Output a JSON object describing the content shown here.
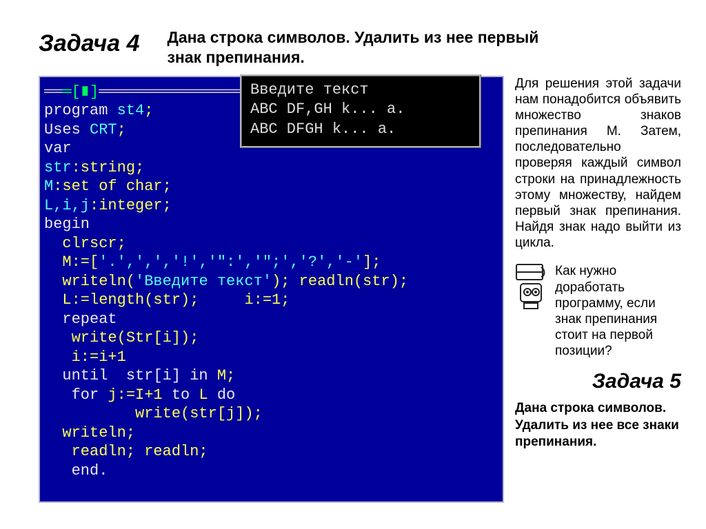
{
  "task4": {
    "title": "Задача 4",
    "desc": "Дана строка символов. Удалить из нее первый знак препинания."
  },
  "console": {
    "line1": "Введите текст",
    "line2": "ABC DF,GH k... a.",
    "line3": "ABC DFGH k... a."
  },
  "code": {
    "topbar": "═[∎]",
    "l1a": "program ",
    "l1b": "st4",
    "l1c": ";",
    "l2a": "Uses ",
    "l2b": "CRT",
    "l2c": ";",
    "l3": "var",
    "l4a": "str",
    "l4b": ":string;",
    "l5a": "M",
    "l5b": ":set of char;",
    "l6a": "L,i,j",
    "l6b": ":integer;",
    "l7": "begin",
    "l8": "  clrscr;",
    "l9a": "  M:=[",
    "l9b": "'.',',','!','\":','\";','?','-'",
    "l9c": "];",
    "l10a": "  writeln(",
    "l10b": "'Введите текст'",
    "l10c": "); readln(str);",
    "l11": "  L:=length(str);     i:=1;",
    "l12": "  repeat",
    "l13": "   write(Str[i]);",
    "l14": "   i:=i+1",
    "l15a": "  until  str[i] ",
    "l15b": "in",
    "l15c": " M;",
    "l16a": "   for ",
    "l16b": "j:=I+1 ",
    "l16c": "to ",
    "l16d": "L ",
    "l16e": "do",
    "l17": "          write(str[j]);",
    "l18": "  writeln;",
    "l19": "   readln; readln;",
    "l20": "   end."
  },
  "explain": "Для решения этой задачи нам понадобится объявить множество знаков препинания M. Затем, последовательно проверяя каждый символ строки на принадлежность этому множеству, найдем первый знак препинания. Найдя знак надо выйти из цикла.",
  "hint": "Как нужно доработать программу, если знак препинания стоит на первой позиции?",
  "task5": {
    "title": "Задача 5",
    "desc": "Дана строка символов. Удалить из нее все знаки препинания."
  }
}
